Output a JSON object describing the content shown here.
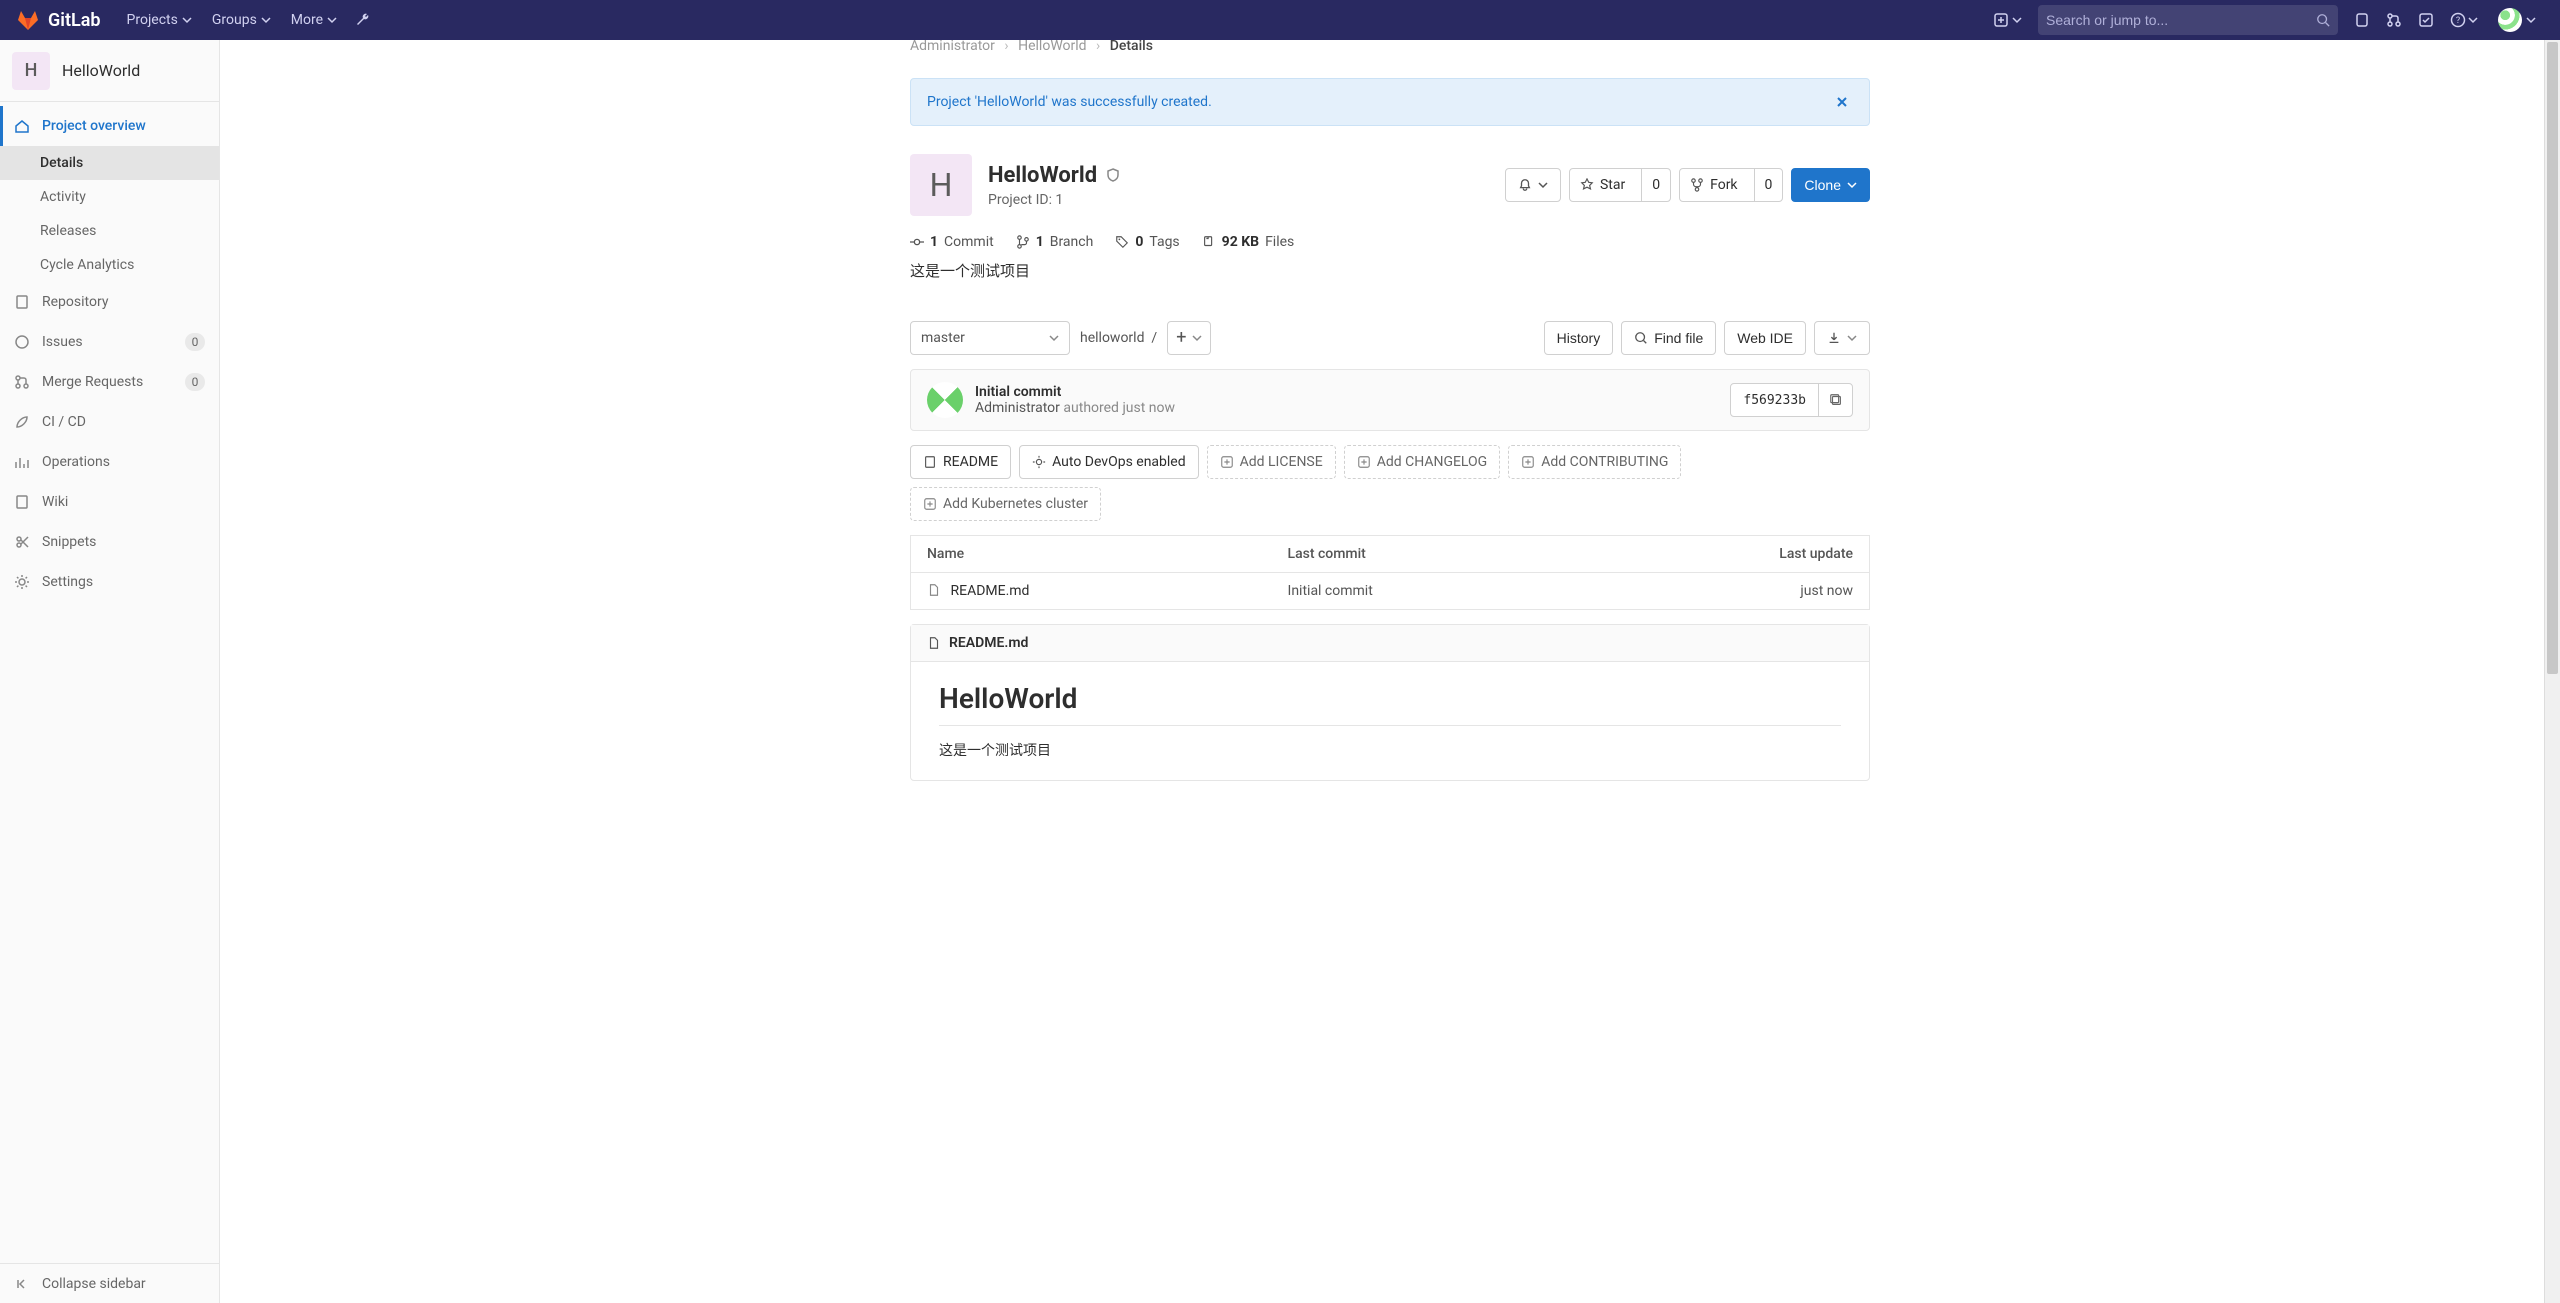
{
  "navbar": {
    "brand": "GitLab",
    "projects": "Projects",
    "groups": "Groups",
    "more": "More",
    "search_placeholder": "Search or jump to..."
  },
  "sidebar": {
    "project_initial": "H",
    "project_name": "HelloWorld",
    "overview": "Project overview",
    "sub_details": "Details",
    "sub_activity": "Activity",
    "sub_releases": "Releases",
    "sub_cycle": "Cycle Analytics",
    "repository": "Repository",
    "issues": "Issues",
    "issues_count": "0",
    "merge": "Merge Requests",
    "merge_count": "0",
    "cicd": "CI / CD",
    "operations": "Operations",
    "wiki": "Wiki",
    "snippets": "Snippets",
    "settings": "Settings",
    "collapse": "Collapse sidebar"
  },
  "breadcrumb": {
    "a": "Administrator",
    "b": "HelloWorld",
    "c": "Details"
  },
  "alert": {
    "msg": "Project 'HelloWorld' was successfully created."
  },
  "project": {
    "initial": "H",
    "name": "HelloWorld",
    "id_label": "Project ID: 1",
    "star": "Star",
    "star_count": "0",
    "fork": "Fork",
    "fork_count": "0",
    "clone": "Clone"
  },
  "stats": {
    "commits_n": "1",
    "commits_l": "Commit",
    "branches_n": "1",
    "branches_l": "Branch",
    "tags_n": "0",
    "tags_l": "Tags",
    "size": "92 KB",
    "size_l": "Files"
  },
  "project_desc": "这是一个测试项目",
  "repo": {
    "branch": "master",
    "path": "helloworld",
    "history": "History",
    "find_file": "Find file",
    "web_ide": "Web IDE"
  },
  "commit": {
    "title": "Initial commit",
    "author": "Administrator",
    "authored": "authored",
    "when": "just now",
    "sha": "f569233b"
  },
  "chips": {
    "readme": "README",
    "autodevops": "Auto DevOps enabled",
    "license": "Add LICENSE",
    "changelog": "Add CHANGELOG",
    "contrib": "Add CONTRIBUTING",
    "k8s": "Add Kubernetes cluster"
  },
  "table": {
    "h_name": "Name",
    "h_commit": "Last commit",
    "h_update": "Last update",
    "rows": [
      {
        "name": "README.md",
        "commit": "Initial commit",
        "update": "just now"
      }
    ]
  },
  "readme": {
    "file": "README.md",
    "heading": "HelloWorld",
    "body": "这是一个测试项目"
  }
}
